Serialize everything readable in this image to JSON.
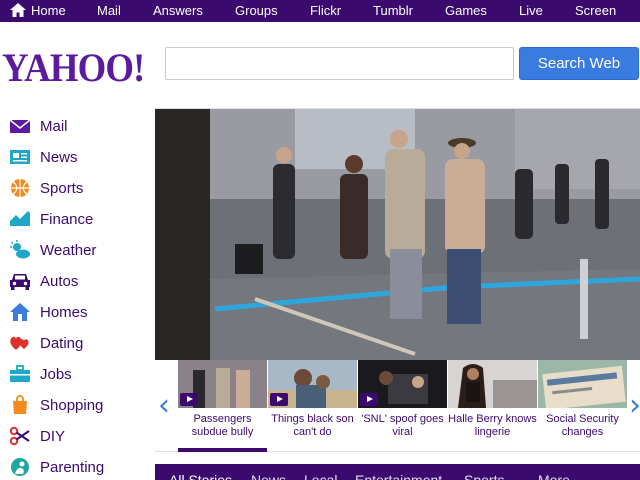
{
  "topnav": {
    "items": [
      "Home",
      "Mail",
      "Answers",
      "Groups",
      "Flickr",
      "Tumblr",
      "Games",
      "Live",
      "Screen"
    ]
  },
  "header": {
    "logo": "YAHOO!",
    "search_placeholder": "",
    "search_button": "Search Web"
  },
  "sidebar": {
    "items": [
      {
        "label": "Mail",
        "icon": "mail-icon"
      },
      {
        "label": "News",
        "icon": "news-icon"
      },
      {
        "label": "Sports",
        "icon": "sports-icon"
      },
      {
        "label": "Finance",
        "icon": "finance-icon"
      },
      {
        "label": "Weather",
        "icon": "weather-icon"
      },
      {
        "label": "Autos",
        "icon": "autos-icon"
      },
      {
        "label": "Homes",
        "icon": "homes-icon"
      },
      {
        "label": "Dating",
        "icon": "dating-icon"
      },
      {
        "label": "Jobs",
        "icon": "jobs-icon"
      },
      {
        "label": "Shopping",
        "icon": "shopping-icon"
      },
      {
        "label": "DIY",
        "icon": "diy-icon"
      },
      {
        "label": "Parenting",
        "icon": "parenting-icon"
      }
    ]
  },
  "carousel": {
    "prev": "‹",
    "next": "›",
    "items": [
      {
        "caption": "Passengers subdue bully",
        "video": true,
        "active": true
      },
      {
        "caption": "Things black son can't do",
        "video": true,
        "active": false
      },
      {
        "caption": "'SNL' spoof goes viral",
        "video": true,
        "active": false
      },
      {
        "caption": "Halle Berry knows lingerie",
        "video": false,
        "active": false
      },
      {
        "caption": "Social Security changes",
        "video": false,
        "active": false
      }
    ]
  },
  "tabs": {
    "items": [
      "All Stories",
      "News",
      "Local",
      "Entertainment",
      "Sports",
      "More"
    ]
  },
  "colors": {
    "brand": "#3b0a6f",
    "logo": "#5c1a9e",
    "button": "#3a7be0"
  }
}
